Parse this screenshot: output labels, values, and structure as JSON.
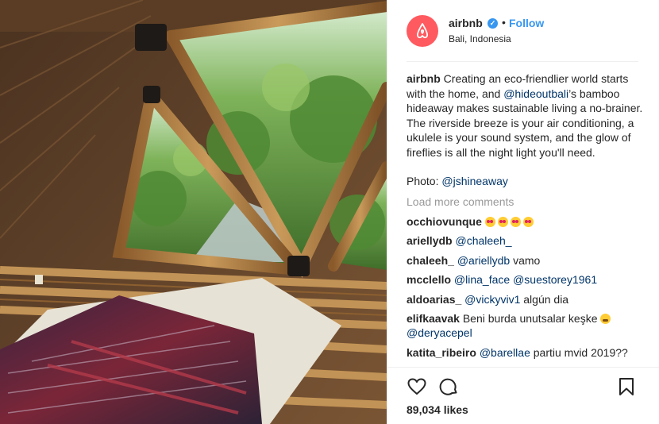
{
  "post": {
    "account": {
      "username": "airbnb",
      "verified_icon": "verified-badge-icon",
      "separator": "•",
      "follow_label": "Follow",
      "location": "Bali, Indonesia",
      "brand_color": "#ff5a5f",
      "link_color": "#3897f0"
    },
    "caption": {
      "username": "airbnb",
      "text_1": "Creating an eco-friendlier world starts with the home, and ",
      "mention_1": "@hideoutbali",
      "text_2": "’s bamboo hideaway makes sustainable living a no-brainer. The riverside breeze is your air conditioning, a ukulele is your sound system, and the glow of fireflies is all the night light you'll need."
    },
    "photo_credit": {
      "prefix": "Photo: ",
      "mention": "@jshineaway"
    },
    "load_more": "Load more comments",
    "comments": [
      {
        "username": "occhiovunque",
        "text": "",
        "mention": "",
        "emoji": [
          "heart-eyes-emoji",
          "heart-eyes-emoji",
          "heart-eyes-emoji",
          "heart-eyes-emoji"
        ]
      },
      {
        "username": "ariellydb",
        "text": "",
        "mention": "@chaleeh_",
        "emoji": []
      },
      {
        "username": "chaleeh_",
        "text": " vamo",
        "mention": "@ariellydb",
        "emoji": []
      },
      {
        "username": "mcclello",
        "text": "",
        "mention": "@lina_face @suestorey1961",
        "emoji": []
      },
      {
        "username": "aldoarias_",
        "text": " algún dia",
        "mention": "@vickyviv1",
        "emoji": []
      },
      {
        "username": "elifkaavak",
        "text": "Beni burda unutsalar keşke ",
        "mention": "@deryacepel",
        "emoji": [
          "tired-face-emoji"
        ]
      },
      {
        "username": "katita_ribeiro",
        "text": " partiu mvid 2019??",
        "mention": "@barellae",
        "emoji": []
      }
    ],
    "actions": {
      "like_icon": "heart-icon",
      "comment_icon": "comment-icon",
      "save_icon": "bookmark-icon"
    },
    "likes": "89,034 likes"
  }
}
